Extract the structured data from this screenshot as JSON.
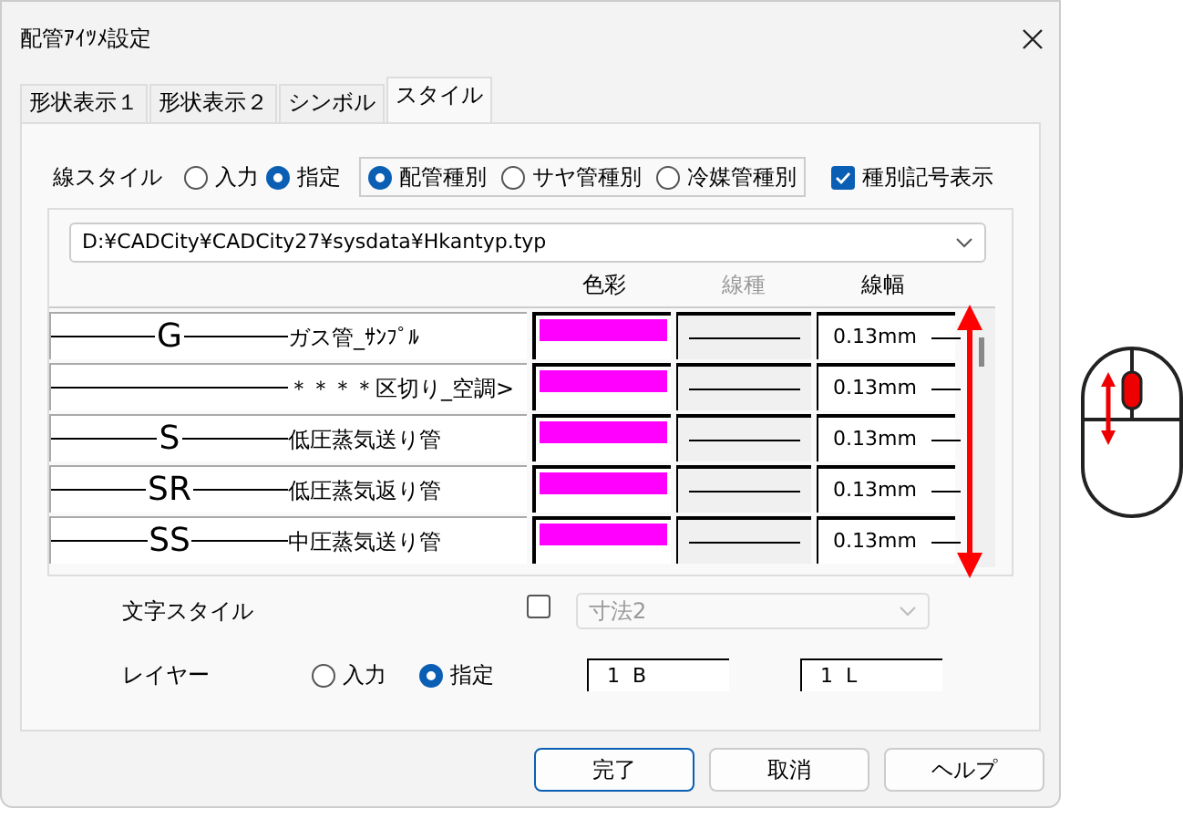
{
  "window": {
    "title": "配管ｱｲﾂﾒ設定"
  },
  "tabs": [
    {
      "label": "形状表示１",
      "selected": false
    },
    {
      "label": "形状表示２",
      "selected": false
    },
    {
      "label": "シンボル",
      "selected": false
    },
    {
      "label": "スタイル",
      "selected": true
    }
  ],
  "line_style": {
    "label": "線スタイル",
    "options": [
      {
        "label": "入力",
        "selected": false
      },
      {
        "label": "指定",
        "selected": true
      }
    ]
  },
  "pipe_category": {
    "options": [
      {
        "label": "配管種別",
        "selected": true
      },
      {
        "label": "サヤ管種別",
        "selected": false
      },
      {
        "label": "冷媒管種別",
        "selected": false
      }
    ]
  },
  "show_type_symbol": {
    "label": "種別記号表示",
    "checked": true
  },
  "file_path": "D:¥CADCity¥CADCity27¥sysdata¥Hkantyp.typ",
  "table": {
    "columns": [
      {
        "label": "色彩",
        "disabled": false
      },
      {
        "label": "線種",
        "disabled": true
      },
      {
        "label": "線幅",
        "disabled": false
      }
    ],
    "rows": [
      {
        "symbol": "G",
        "name": "ガス管_ｻﾝﾌﾟﾙ",
        "color": "#ff00ff",
        "width": "0.13mm"
      },
      {
        "name": "＊＊＊＊区切り_空調>",
        "color": "#ff00ff",
        "width": "0.13mm"
      },
      {
        "symbol": "S",
        "name": "低圧蒸気送り管",
        "color": "#ff00ff",
        "width": "0.13mm"
      },
      {
        "symbol": "SR",
        "name": "低圧蒸気返り管",
        "color": "#ff00ff",
        "width": "0.13mm"
      },
      {
        "symbol": "SS",
        "name": "中圧蒸気送り管",
        "color": "#ff00ff",
        "width": "0.13mm"
      }
    ]
  },
  "text_style": {
    "label": "文字スタイル",
    "checked": false,
    "value": "寸法2",
    "disabled": true
  },
  "layer": {
    "label": "レイヤー",
    "options": [
      {
        "label": "入力",
        "selected": false
      },
      {
        "label": "指定",
        "selected": true
      }
    ],
    "fields": [
      "1  B",
      "1  L"
    ]
  },
  "buttons": [
    {
      "label": "完了",
      "default": true
    },
    {
      "label": "取消",
      "default": false
    },
    {
      "label": "ヘルプ",
      "default": false
    }
  ]
}
